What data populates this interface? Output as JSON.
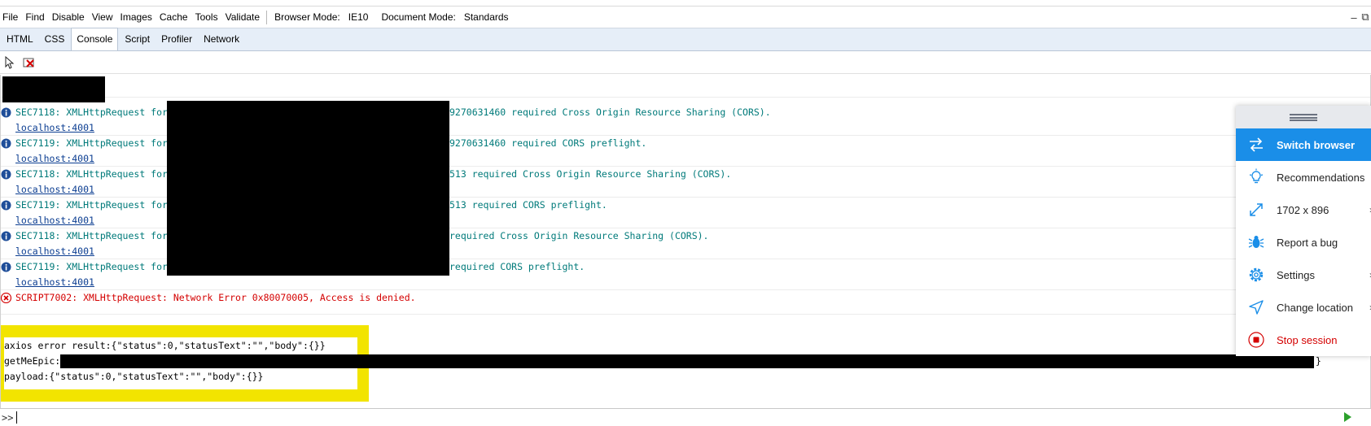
{
  "menu": {
    "items": [
      "File",
      "Find",
      "Disable",
      "View",
      "Images",
      "Cache",
      "Tools",
      "Validate"
    ],
    "browser_mode_label": "Browser Mode:",
    "browser_mode_value": "IE10",
    "document_mode_label": "Document Mode:",
    "document_mode_value": "Standards",
    "minimize": "–",
    "restore": "⧉"
  },
  "tabs": [
    "HTML",
    "CSS",
    "Console",
    "Script",
    "Profiler",
    "Network"
  ],
  "active_tab": "Console",
  "console": {
    "messages": [
      {
        "type": "info",
        "prefix": "SEC7118: XMLHttpRequest for",
        "suffix": "9270631460 required Cross Origin Resource Sharing (CORS).",
        "source": "localhost:4001"
      },
      {
        "type": "info",
        "prefix": "SEC7119: XMLHttpRequest for",
        "suffix": "9270631460 required CORS preflight.",
        "source": "localhost:4001"
      },
      {
        "type": "info",
        "prefix": "SEC7118: XMLHttpRequest for",
        "suffix": "513 required Cross Origin Resource Sharing (CORS).",
        "source": "localhost:4001"
      },
      {
        "type": "info",
        "prefix": "SEC7119: XMLHttpRequest for",
        "suffix": "513 required CORS preflight.",
        "source": "localhost:4001"
      },
      {
        "type": "info",
        "prefix": "SEC7118: XMLHttpRequest for",
        "suffix": "required Cross Origin Resource Sharing (CORS).",
        "source": "localhost:4001"
      },
      {
        "type": "info",
        "prefix": "SEC7119: XMLHttpRequest for",
        "suffix": "required CORS preflight.",
        "source": "localhost:4001"
      }
    ],
    "error": "SCRIPT7002: XMLHttpRequest: Network Error 0x80070005, Access is denied.",
    "output": {
      "line1": "axios error result:{\"status\":0,\"statusText\":\"\",\"body\":{}}",
      "line2_prefix": "getMeEpic:",
      "line2_suffix": "}",
      "line3": "payload:{\"status\":0,\"statusText\":\"\",\"body\":{}}"
    },
    "prompt": ">>"
  },
  "panel": {
    "items": [
      {
        "label": "Switch browser",
        "icon": "switch-arrows-icon"
      },
      {
        "label": "Recommendations",
        "icon": "lightbulb-icon"
      },
      {
        "label": "1702 x 896",
        "icon": "resize-arrows-icon"
      },
      {
        "label": "Report a bug",
        "icon": "bug-icon"
      },
      {
        "label": "Settings",
        "icon": "gear-icon"
      },
      {
        "label": "Change location",
        "icon": "location-arrow-icon"
      },
      {
        "label": "Stop session",
        "icon": "stop-icon"
      }
    ],
    "chevron": "›",
    "accent": "#1a8ee8",
    "stop_color": "#d40000"
  }
}
